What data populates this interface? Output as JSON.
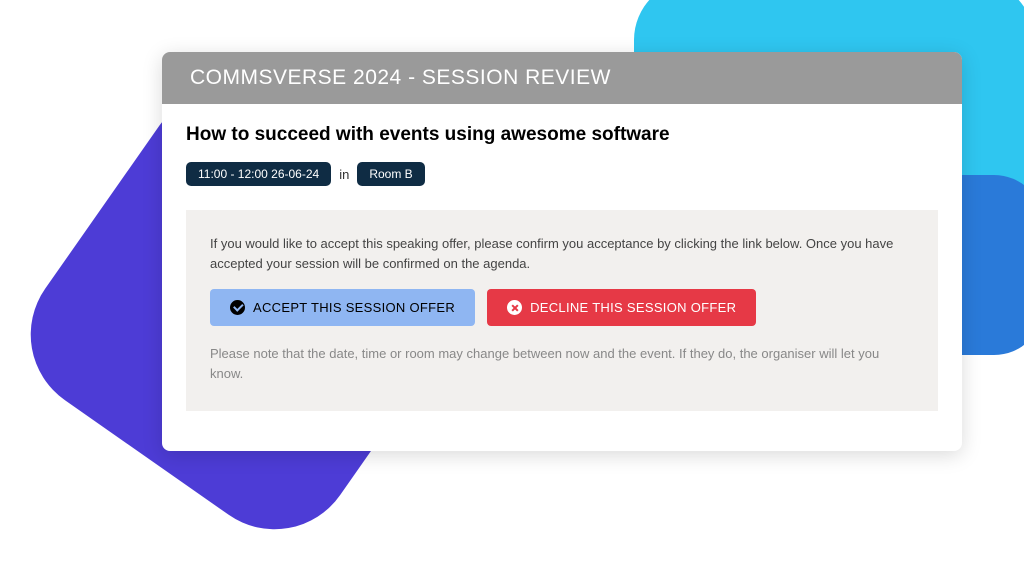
{
  "header": {
    "title": "COMMSVERSE 2024 - SESSION REVIEW"
  },
  "session": {
    "title": "How to succeed with events using awesome software",
    "time_pill": "11:00 - 12:00 26-06-24",
    "in_label": "in",
    "room_pill": "Room B"
  },
  "info": {
    "accept_text": "If you would like to accept this speaking offer, please confirm you acceptance by clicking the link below. Once you have accepted your session will be confirmed on the agenda.",
    "note_text": "Please note that the date, time or room may change between now and the event. If they do, the organiser will let you know."
  },
  "buttons": {
    "accept_label": "ACCEPT THIS SESSION OFFER",
    "decline_label": "DECLINE THIS SESSION OFFER"
  }
}
